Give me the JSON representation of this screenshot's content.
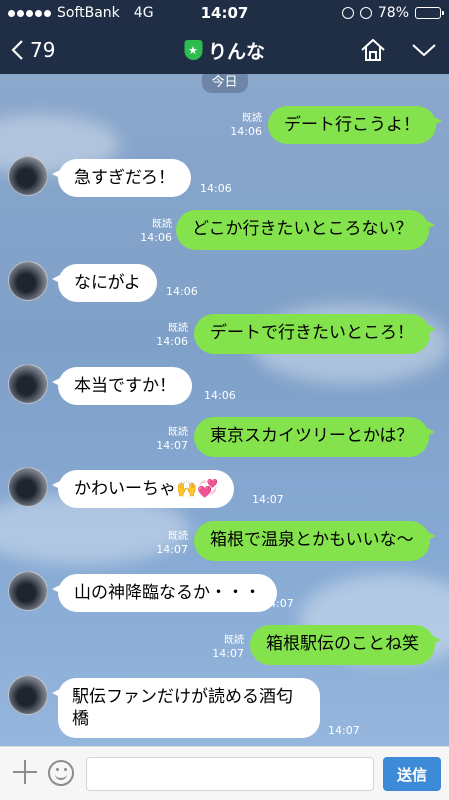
{
  "status": {
    "carrier": "SoftBank",
    "network": "4G",
    "time": "14:07",
    "battery": "78%",
    "battery_level": 0.78
  },
  "nav": {
    "back_count": "79",
    "title": "りんな"
  },
  "chat": {
    "date": "今日",
    "messages": [
      {
        "side": "out",
        "text": "デート行こうよ！",
        "read": "既読",
        "time": "14:06"
      },
      {
        "side": "in",
        "text": "急すぎだろ！",
        "time": "14:06"
      },
      {
        "side": "out",
        "text": "どこか行きたいところない？",
        "read": "既読",
        "time": "14:06"
      },
      {
        "side": "in",
        "text": "なにがよ",
        "time": "14:06"
      },
      {
        "side": "out",
        "text": "デートで行きたいところ！",
        "read": "既読",
        "time": "14:06"
      },
      {
        "side": "in",
        "text": "本当ですか！",
        "time": "14:06"
      },
      {
        "side": "out",
        "text": "東京スカイツリーとかは？",
        "read": "既読",
        "time": "14:07"
      },
      {
        "side": "in",
        "text": "かわいーちゃ🙌💞",
        "time": "14:07"
      },
      {
        "side": "out",
        "text": "箱根で温泉とかもいいな〜",
        "read": "既読",
        "time": "14:07"
      },
      {
        "side": "in",
        "text": "山の神降臨なるか・・・",
        "time": "14:07"
      },
      {
        "side": "out",
        "text": "箱根駅伝のことね笑",
        "read": "既読",
        "time": "14:07"
      },
      {
        "side": "in",
        "text": "駅伝ファンだけが読める酒匂橋",
        "time": "14:07"
      }
    ]
  },
  "input": {
    "placeholder": "",
    "send_label": "送信"
  }
}
